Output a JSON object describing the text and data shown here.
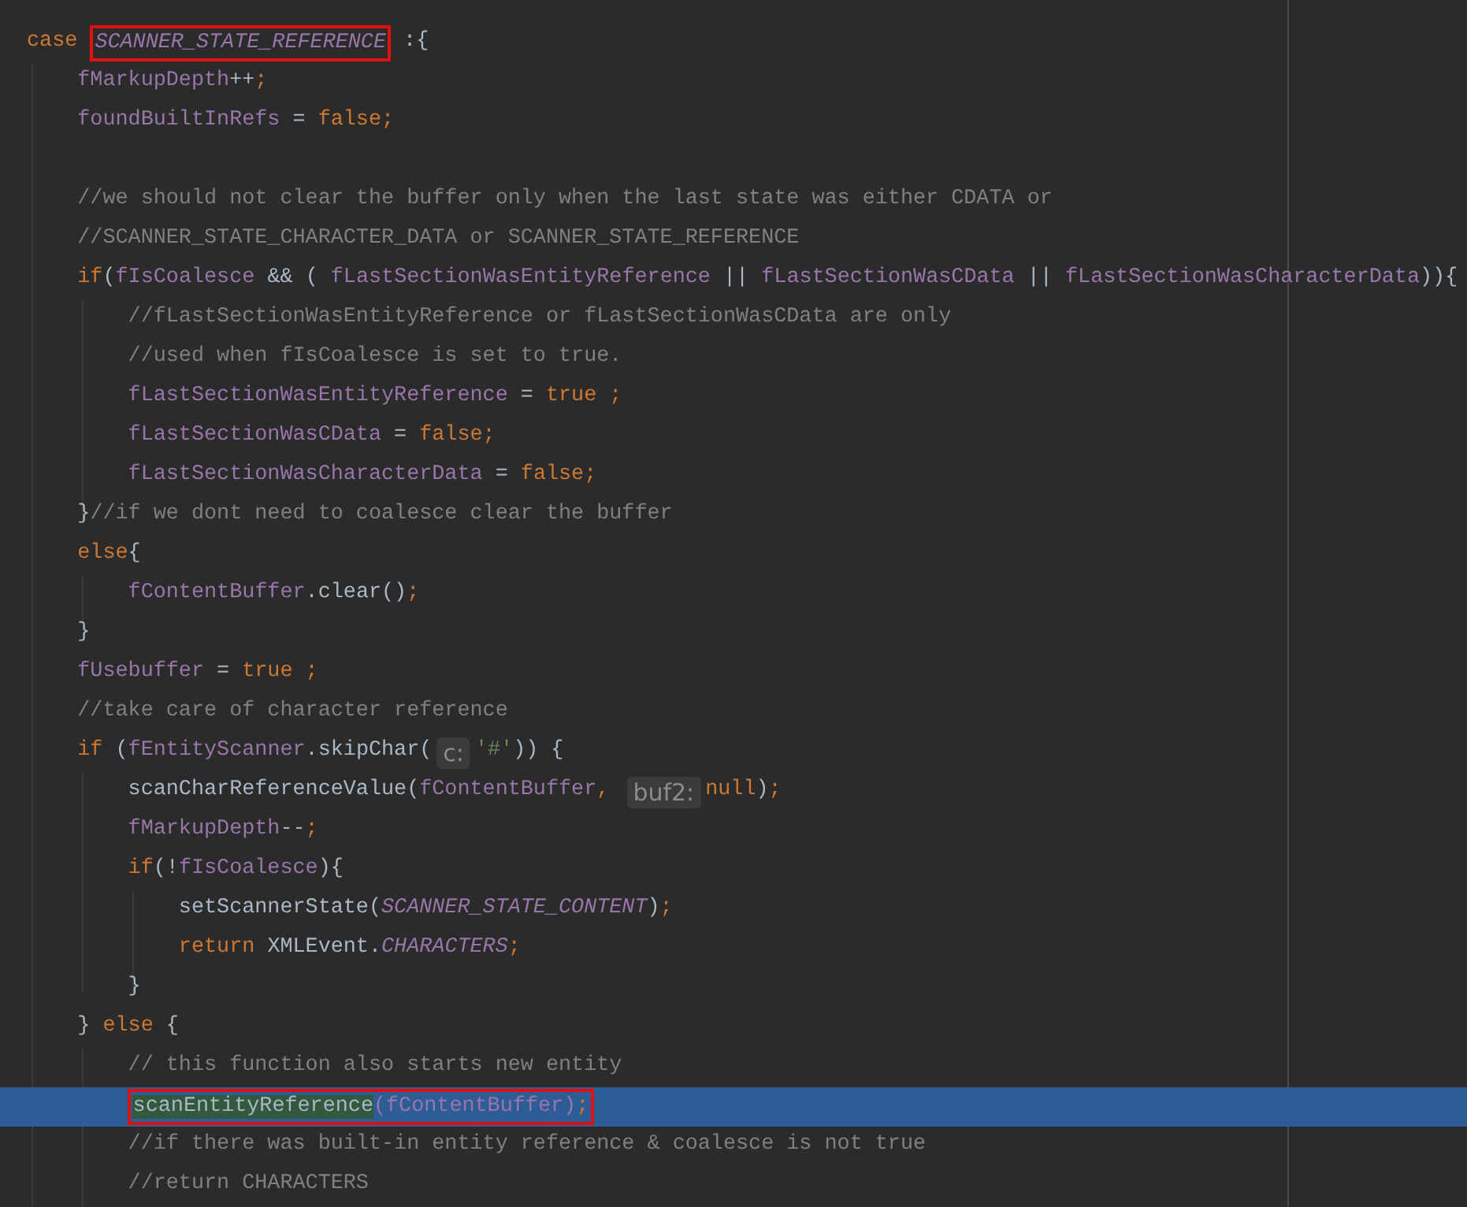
{
  "lines": [
    {
      "kind": "code",
      "selected": false,
      "tokens": [
        {
          "kind": "keyword",
          "text": "case "
        },
        {
          "kind": "constant",
          "text": "SCANNER_STATE_REFERENCE",
          "boxed": true
        },
        {
          "kind": "plain",
          "text": " :{"
        }
      ]
    },
    {
      "kind": "code",
      "selected": false,
      "tokens": [
        {
          "kind": "field",
          "text": "    fMarkupDepth"
        },
        {
          "kind": "plain",
          "text": "++"
        },
        {
          "kind": "punct",
          "text": ";"
        }
      ]
    },
    {
      "kind": "code",
      "selected": false,
      "tokens": [
        {
          "kind": "field",
          "text": "    foundBuiltInRefs"
        },
        {
          "kind": "plain",
          "text": " = "
        },
        {
          "kind": "keyword",
          "text": "false"
        },
        {
          "kind": "punct",
          "text": ";"
        }
      ]
    },
    {
      "kind": "blank",
      "selected": false
    },
    {
      "kind": "code",
      "selected": false,
      "tokens": [
        {
          "kind": "comment",
          "text": "    //we should not clear the buffer only when the last state was either CDATA or"
        }
      ]
    },
    {
      "kind": "code",
      "selected": false,
      "tokens": [
        {
          "kind": "comment",
          "text": "    //SCANNER_STATE_CHARACTER_DATA or SCANNER_STATE_REFERENCE"
        }
      ]
    },
    {
      "kind": "code",
      "selected": false,
      "tokens": [
        {
          "kind": "keyword",
          "text": "    if"
        },
        {
          "kind": "plain",
          "text": "("
        },
        {
          "kind": "field",
          "text": "fIsCoalesce"
        },
        {
          "kind": "plain",
          "text": " && ( "
        },
        {
          "kind": "field",
          "text": "fLastSectionWasEntityReference"
        },
        {
          "kind": "plain",
          "text": " || "
        },
        {
          "kind": "field",
          "text": "fLastSectionWasCData"
        },
        {
          "kind": "plain",
          "text": " || "
        },
        {
          "kind": "field",
          "text": "fLastSectionWasCharacterData"
        },
        {
          "kind": "plain",
          "text": ")){"
        }
      ]
    },
    {
      "kind": "code",
      "selected": false,
      "tokens": [
        {
          "kind": "comment",
          "text": "        //fLastSectionWasEntityReference or fLastSectionWasCData are only"
        }
      ]
    },
    {
      "kind": "code",
      "selected": false,
      "tokens": [
        {
          "kind": "comment",
          "text": "        //used when fIsCoalesce is set to true."
        }
      ]
    },
    {
      "kind": "code",
      "selected": false,
      "tokens": [
        {
          "kind": "field",
          "text": "        fLastSectionWasEntityReference"
        },
        {
          "kind": "plain",
          "text": " = "
        },
        {
          "kind": "keyword",
          "text": "true"
        },
        {
          "kind": "punct",
          "text": " ;"
        }
      ]
    },
    {
      "kind": "code",
      "selected": false,
      "tokens": [
        {
          "kind": "field",
          "text": "        fLastSectionWasCData"
        },
        {
          "kind": "plain",
          "text": " = "
        },
        {
          "kind": "keyword",
          "text": "false"
        },
        {
          "kind": "punct",
          "text": ";"
        }
      ]
    },
    {
      "kind": "code",
      "selected": false,
      "tokens": [
        {
          "kind": "field",
          "text": "        fLastSectionWasCharacterData"
        },
        {
          "kind": "plain",
          "text": " = "
        },
        {
          "kind": "keyword",
          "text": "false"
        },
        {
          "kind": "punct",
          "text": ";"
        }
      ]
    },
    {
      "kind": "code",
      "selected": false,
      "tokens": [
        {
          "kind": "plain",
          "text": "    }"
        },
        {
          "kind": "comment",
          "text": "//if we dont need to coalesce clear the buffer"
        }
      ]
    },
    {
      "kind": "code",
      "selected": false,
      "tokens": [
        {
          "kind": "keyword",
          "text": "    else"
        },
        {
          "kind": "plain",
          "text": "{"
        }
      ]
    },
    {
      "kind": "code",
      "selected": false,
      "tokens": [
        {
          "kind": "field",
          "text": "        fContentBuffer"
        },
        {
          "kind": "plain",
          "text": ".clear()"
        },
        {
          "kind": "punct",
          "text": ";"
        }
      ]
    },
    {
      "kind": "code",
      "selected": false,
      "tokens": [
        {
          "kind": "plain",
          "text": "    }"
        }
      ]
    },
    {
      "kind": "code",
      "selected": false,
      "tokens": [
        {
          "kind": "field",
          "text": "    fUsebuffer"
        },
        {
          "kind": "plain",
          "text": " = "
        },
        {
          "kind": "keyword",
          "text": "true"
        },
        {
          "kind": "punct",
          "text": " ;"
        }
      ]
    },
    {
      "kind": "code",
      "selected": false,
      "tokens": [
        {
          "kind": "comment",
          "text": "    //take care of character reference"
        }
      ]
    },
    {
      "kind": "code",
      "selected": false,
      "tokens": [
        {
          "kind": "keyword",
          "text": "    if "
        },
        {
          "kind": "plain",
          "text": "("
        },
        {
          "kind": "field",
          "text": "fEntityScanner"
        },
        {
          "kind": "plain",
          "text": ".skipChar("
        },
        {
          "kind": "hint",
          "text": "c:"
        },
        {
          "kind": "string",
          "text": "'#'"
        },
        {
          "kind": "plain",
          "text": ")) {"
        }
      ]
    },
    {
      "kind": "code",
      "selected": false,
      "tokens": [
        {
          "kind": "plain",
          "text": "        scanCharReferenceValue("
        },
        {
          "kind": "field",
          "text": "fContentBuffer"
        },
        {
          "kind": "punct",
          "text": ", "
        },
        {
          "kind": "hint",
          "text": "buf2:"
        },
        {
          "kind": "keyword",
          "text": "null"
        },
        {
          "kind": "plain",
          "text": ")"
        },
        {
          "kind": "punct",
          "text": ";"
        }
      ]
    },
    {
      "kind": "code",
      "selected": false,
      "tokens": [
        {
          "kind": "field",
          "text": "        fMarkupDepth"
        },
        {
          "kind": "plain",
          "text": "--"
        },
        {
          "kind": "punct",
          "text": ";"
        }
      ]
    },
    {
      "kind": "code",
      "selected": false,
      "tokens": [
        {
          "kind": "keyword",
          "text": "        if"
        },
        {
          "kind": "plain",
          "text": "(!"
        },
        {
          "kind": "field",
          "text": "fIsCoalesce"
        },
        {
          "kind": "plain",
          "text": "){"
        }
      ]
    },
    {
      "kind": "code",
      "selected": false,
      "tokens": [
        {
          "kind": "plain",
          "text": "            setScannerState("
        },
        {
          "kind": "constant",
          "text": "SCANNER_STATE_CONTENT"
        },
        {
          "kind": "plain",
          "text": ")"
        },
        {
          "kind": "punct",
          "text": ";"
        }
      ]
    },
    {
      "kind": "code",
      "selected": false,
      "tokens": [
        {
          "kind": "keyword",
          "text": "            return "
        },
        {
          "kind": "plain",
          "text": "XMLEvent."
        },
        {
          "kind": "constant",
          "text": "CHARACTERS"
        },
        {
          "kind": "punct",
          "text": ";"
        }
      ]
    },
    {
      "kind": "code",
      "selected": false,
      "tokens": [
        {
          "kind": "plain",
          "text": "        }"
        }
      ]
    },
    {
      "kind": "code",
      "selected": false,
      "tokens": [
        {
          "kind": "plain",
          "text": "    } "
        },
        {
          "kind": "keyword",
          "text": "else"
        },
        {
          "kind": "plain",
          "text": " {"
        }
      ]
    },
    {
      "kind": "code",
      "selected": false,
      "tokens": [
        {
          "kind": "comment",
          "text": "        // this function also starts new entity"
        }
      ]
    },
    {
      "kind": "code",
      "selected": true,
      "tokens": [
        {
          "kind": "usage",
          "text": "        scanEntityReference",
          "boxed": true
        },
        {
          "kind": "field",
          "text": "(fContentBuffer)",
          "boxed": true
        },
        {
          "kind": "punct",
          "text": ";",
          "boxed": true
        }
      ]
    },
    {
      "kind": "code",
      "selected": false,
      "tokens": [
        {
          "kind": "comment",
          "text": "        //if there was built-in entity reference & coalesce is not true"
        }
      ]
    },
    {
      "kind": "code",
      "selected": false,
      "tokens": [
        {
          "kind": "comment",
          "text": "        //return CHARACTERS"
        }
      ]
    }
  ]
}
